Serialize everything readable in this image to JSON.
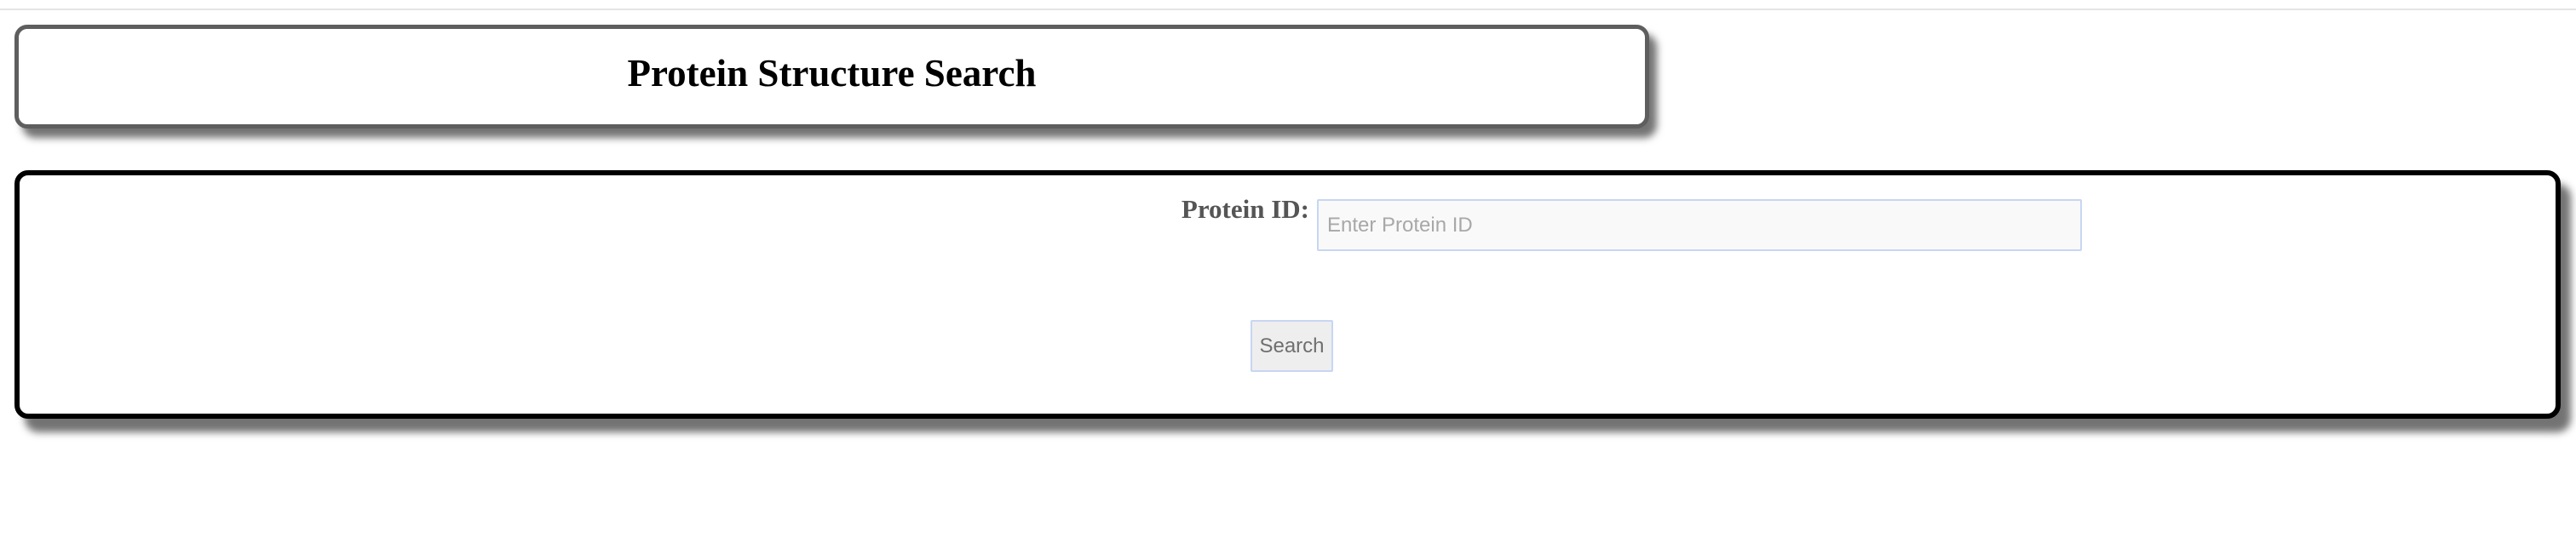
{
  "header": {
    "title": "Protein Structure Search"
  },
  "search_form": {
    "label": "Protein ID:",
    "input_value": "",
    "input_placeholder": "Enter Protein ID",
    "button_label": "Search"
  },
  "colors": {
    "header_border": "#5e5e5e",
    "form_border": "#000000",
    "input_border": "#c8d6f3",
    "input_background": "#f9f9f9",
    "button_background": "#eeeeee",
    "label_text": "#555555"
  }
}
